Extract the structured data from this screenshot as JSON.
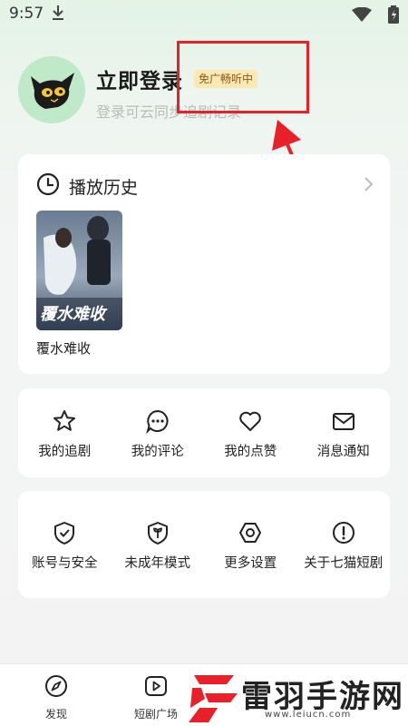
{
  "status_bar": {
    "time": "9:57"
  },
  "profile": {
    "title": "立即登录",
    "badge": "免广畅听中",
    "subtitle": "登录可云同步追剧记录"
  },
  "history": {
    "title": "播放历史",
    "items": [
      {
        "name": "覆水难收",
        "poster_text": "覆水难收"
      }
    ]
  },
  "grid_one": [
    {
      "label": "我的追剧",
      "icon": "star-icon"
    },
    {
      "label": "我的评论",
      "icon": "comment-icon"
    },
    {
      "label": "我的点赞",
      "icon": "heart-icon"
    },
    {
      "label": "消息通知",
      "icon": "mail-icon"
    }
  ],
  "grid_two": [
    {
      "label": "账号与安全",
      "icon": "shield-icon"
    },
    {
      "label": "未成年模式",
      "icon": "sprout-shield-icon"
    },
    {
      "label": "更多设置",
      "icon": "settings-hex-icon"
    },
    {
      "label": "关于七猫短剧",
      "icon": "info-icon"
    }
  ],
  "bottom_nav": [
    {
      "label": "发现",
      "icon": "compass-icon"
    },
    {
      "label": "短剧广场",
      "icon": "play-square-icon"
    }
  ],
  "watermark": {
    "text": "雷羽手游网",
    "url": "www.leiucn.com"
  },
  "colors": {
    "accent_red": "#e8202a",
    "badge_bg": "#fbe8b3",
    "avatar_bg": "#bfe9c9"
  }
}
